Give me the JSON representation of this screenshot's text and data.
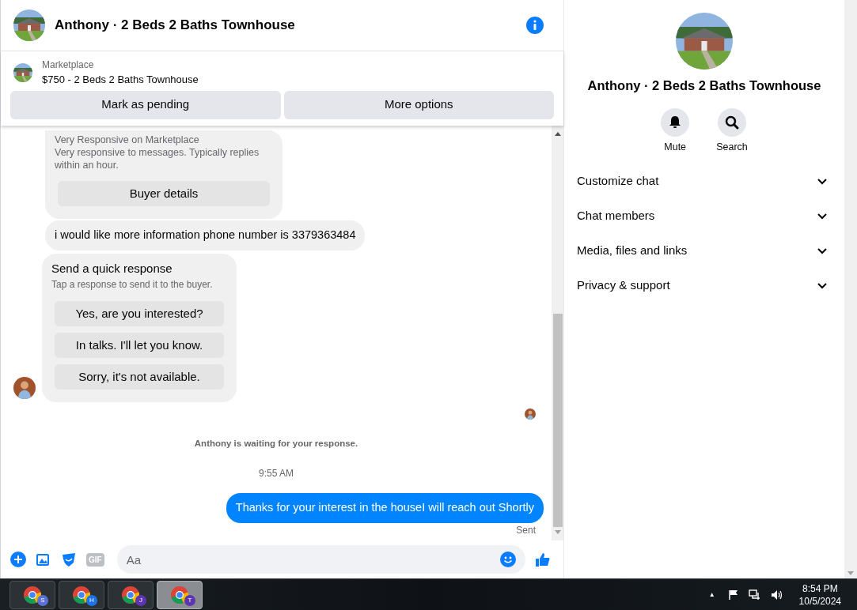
{
  "header": {
    "title": "Anthony · 2 Beds 2 Baths Townhouse"
  },
  "listing": {
    "source": "Marketplace",
    "title": "$750 - 2 Beds 2 Baths Townhouse",
    "actions": [
      "Mark as pending",
      "More options"
    ]
  },
  "buyer_card": {
    "lines": [
      "Very Responsive on Marketplace",
      "Very responsive to messages. Typically replies within an hour."
    ],
    "button": "Buyer details"
  },
  "incoming_message": "i would like more information phone number is 3379363484",
  "quick_response": {
    "title": "Send a quick response",
    "subtitle": "Tap a response to send it to the buyer.",
    "options": [
      "Yes, are you interested?",
      "In talks. I'll let you know.",
      "Sorry, it's not available."
    ]
  },
  "waiting_notice": "Anthony is waiting for your response.",
  "timestamp": "9:55 AM",
  "outgoing_message": "Thanks for your interest in the houseI will reach out Shortly",
  "delivery_status": "Sent",
  "composer": {
    "placeholder": "Aa",
    "gif_label": "GIF"
  },
  "details": {
    "title": "Anthony · 2 Beds 2 Baths Townhouse",
    "actions": [
      {
        "kind": "mute",
        "label": "Mute"
      },
      {
        "kind": "search",
        "label": "Search"
      }
    ],
    "sections": [
      {
        "label": "Customize chat",
        "expanded": false
      },
      {
        "label": "Chat members",
        "expanded": false
      },
      {
        "label": "Media, files and links",
        "expanded": false
      },
      {
        "label": "Privacy & support",
        "expanded": false
      }
    ]
  },
  "taskbar": {
    "apps": [
      {
        "badge": "S",
        "color": "#5b6fd6",
        "selected": false
      },
      {
        "badge": "H",
        "color": "#1a73e8",
        "selected": false
      },
      {
        "badge": "J",
        "color": "#5e35b1",
        "selected": false
      },
      {
        "badge": "T",
        "color": "#5e35b1",
        "selected": true
      }
    ],
    "tray_arrow": "▲",
    "time": "8:54 PM",
    "date": "10/5/2024"
  }
}
